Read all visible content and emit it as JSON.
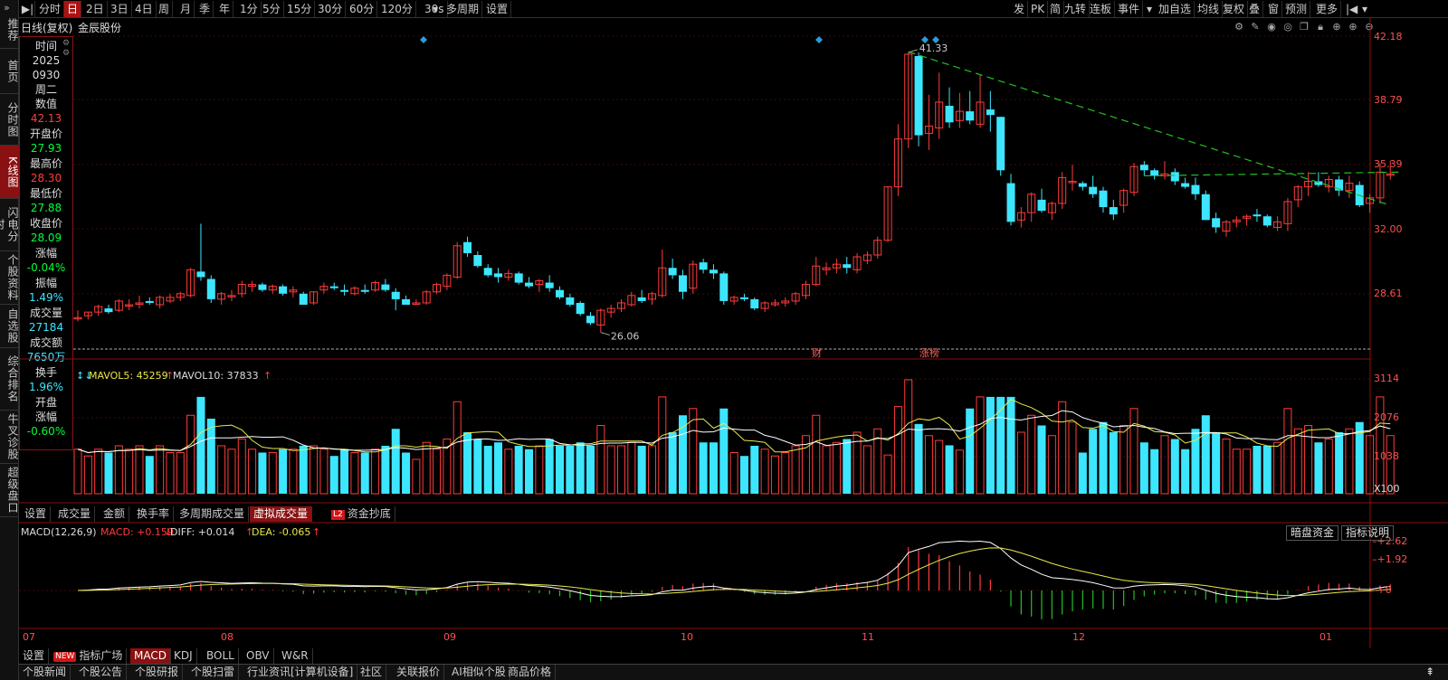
{
  "left_nav": [
    "推荐",
    "首页",
    "分时图",
    "K线图",
    "闪电分时",
    "个股资料",
    "自选股",
    "综合排名",
    "牛叉诊股",
    "超级盘口"
  ],
  "left_nav_active": "K线图",
  "toolbar": {
    "left": [
      "分时",
      "日",
      "2日",
      "3日",
      "4日",
      "周",
      "月",
      "季",
      "年",
      "1分",
      "5分",
      "15分",
      "30分",
      "60分",
      "120分",
      "30s",
      "多周期",
      "设置"
    ],
    "active": "日",
    "right": [
      "发",
      "PK",
      "简",
      "九转",
      "连板",
      "事件",
      "加自选",
      "均线",
      "复权",
      "叠",
      "窗",
      "预测",
      "更多"
    ]
  },
  "chart_header": {
    "mode": "日线(复权)",
    "stock_name": "金辰股份"
  },
  "info_panel": [
    {
      "label": "时间",
      "value": ""
    },
    {
      "label": "2025",
      "value": "",
      "style": "white"
    },
    {
      "label": "0930",
      "value": "",
      "style": "white"
    },
    {
      "label": "周二",
      "value": ""
    },
    {
      "label": "数值",
      "value": "42.13",
      "style": "red"
    },
    {
      "label": "开盘价",
      "value": "27.93",
      "style": "green"
    },
    {
      "label": "最高价",
      "value": "28.30",
      "style": "red"
    },
    {
      "label": "最低价",
      "value": "27.88",
      "style": "green"
    },
    {
      "label": "收盘价",
      "value": "28.09",
      "style": "green"
    },
    {
      "label": "涨幅",
      "value": "-0.04%",
      "style": "green"
    },
    {
      "label": "振幅",
      "value": "1.49%",
      "style": "cyan"
    },
    {
      "label": "成交量",
      "value": "27184",
      "style": "cyan"
    },
    {
      "label": "成交额",
      "value": "7650万",
      "style": "cyan"
    },
    {
      "label": "换手",
      "value": "1.96%",
      "style": "cyan"
    },
    {
      "label": "开盘",
      "value": "",
      "style": "white"
    },
    {
      "label": "涨幅",
      "value": "-0.60%",
      "style": "green"
    }
  ],
  "price_axis": [
    "42.18",
    "38.79",
    "35.39",
    "32.00",
    "28.61"
  ],
  "price_annotations": {
    "high": "41.33",
    "low": "26.06"
  },
  "event_markers": [
    "财",
    "涨榜"
  ],
  "volume_legend": {
    "mavol5_label": "MAVOL5: 45259",
    "mavol10_label": "MAVOL10: 37833"
  },
  "volume_axis": [
    "3114",
    "2076",
    "1038",
    "X100"
  ],
  "indicator_tabs": [
    "设置",
    "成交量",
    "金额",
    "换手率",
    "多周期成交量",
    "虚拟成交量",
    "资金抄底"
  ],
  "indicator_tabs_active": "虚拟成交量",
  "indicator_l2_tab": "资金抄底",
  "macd_legend": {
    "title": "MACD(12,26,9)",
    "macd": "MACD: +0.159",
    "diff": "DIFF: +0.014",
    "dea": "DEA: -0.065"
  },
  "macd_buttons": [
    "暗盘资金",
    "指标说明"
  ],
  "macd_axis": [
    "+2.62",
    "+1.92",
    "+0"
  ],
  "date_axis": [
    "07",
    "08",
    "09",
    "10",
    "11",
    "12",
    "01"
  ],
  "bottom_tabs": [
    "设置",
    "指标广场",
    "MACD",
    "KDJ",
    "BOLL",
    "OBV",
    "W&R"
  ],
  "bottom_tabs_new": "指标广场",
  "bottom_tabs_active": "MACD",
  "footer_tabs": [
    "个股新闻",
    "个股公告",
    "个股研报",
    "个股扫雷",
    "行业资讯[计算机设备]",
    "社区",
    "关联报价",
    "AI相似个股",
    "商品价格"
  ],
  "colors": {
    "up": "#ff3b3b",
    "down": "#3ce6ff",
    "ma5": "#e8e84a",
    "ma10": "#ffffff",
    "accent": "#b01010",
    "trend": "#22c022"
  },
  "chart_data": {
    "type": "candlestick",
    "ylim": [
      24.9,
      42.18
    ],
    "candles": [
      [
        26.9,
        27.3,
        26.7,
        26.9
      ],
      [
        27.0,
        27.2,
        26.8,
        27.2
      ],
      [
        27.2,
        27.6,
        27.0,
        27.5
      ],
      [
        27.4,
        27.6,
        27.1,
        27.2
      ],
      [
        27.3,
        27.9,
        27.2,
        27.8
      ],
      [
        27.6,
        27.9,
        27.3,
        27.6
      ],
      [
        27.7,
        28.1,
        27.4,
        27.7
      ],
      [
        27.8,
        28.0,
        27.6,
        27.7
      ],
      [
        27.6,
        28.1,
        27.4,
        28.0
      ],
      [
        27.8,
        28.2,
        27.7,
        28.0
      ],
      [
        28.0,
        28.3,
        27.8,
        28.2
      ],
      [
        28.1,
        29.6,
        28.0,
        29.5
      ],
      [
        29.4,
        32.0,
        28.9,
        29.1
      ],
      [
        29.0,
        29.2,
        27.7,
        27.9
      ],
      [
        27.9,
        28.3,
        27.6,
        28.2
      ],
      [
        28.1,
        28.4,
        27.8,
        28.1
      ],
      [
        28.2,
        28.9,
        28.0,
        28.7
      ],
      [
        28.6,
        28.9,
        28.3,
        28.7
      ],
      [
        28.7,
        28.8,
        28.3,
        28.4
      ],
      [
        28.4,
        28.7,
        28.2,
        28.6
      ],
      [
        28.6,
        28.7,
        28.1,
        28.2
      ],
      [
        28.3,
        28.6,
        28.0,
        28.4
      ],
      [
        28.2,
        28.3,
        27.6,
        27.6
      ],
      [
        27.7,
        28.3,
        27.6,
        28.3
      ],
      [
        28.4,
        28.8,
        28.2,
        28.6
      ],
      [
        28.6,
        28.8,
        28.4,
        28.5
      ],
      [
        28.4,
        28.7,
        28.1,
        28.3
      ],
      [
        28.2,
        28.6,
        28.1,
        28.5
      ],
      [
        28.4,
        28.7,
        28.2,
        28.3
      ],
      [
        28.4,
        28.9,
        28.3,
        28.8
      ],
      [
        28.7,
        29.0,
        28.3,
        28.4
      ],
      [
        28.3,
        28.5,
        27.3,
        27.9
      ],
      [
        27.9,
        28.1,
        27.6,
        27.6
      ],
      [
        27.7,
        27.9,
        27.6,
        27.7
      ],
      [
        27.7,
        28.4,
        27.6,
        28.3
      ],
      [
        28.3,
        28.8,
        28.2,
        28.7
      ],
      [
        28.6,
        29.3,
        28.4,
        29.2
      ],
      [
        29.1,
        31.0,
        29.0,
        30.8
      ],
      [
        31.0,
        31.3,
        30.2,
        30.4
      ],
      [
        30.3,
        30.5,
        29.6,
        29.7
      ],
      [
        29.6,
        29.8,
        29.1,
        29.2
      ],
      [
        29.3,
        29.6,
        28.8,
        29.1
      ],
      [
        29.1,
        29.5,
        28.9,
        29.3
      ],
      [
        29.3,
        29.4,
        28.7,
        28.8
      ],
      [
        28.8,
        29.1,
        28.5,
        28.6
      ],
      [
        28.7,
        29.0,
        28.3,
        28.9
      ],
      [
        28.8,
        29.2,
        28.3,
        28.5
      ],
      [
        28.4,
        28.6,
        27.9,
        28.0
      ],
      [
        28.0,
        28.2,
        27.5,
        27.6
      ],
      [
        27.7,
        27.8,
        27.0,
        27.1
      ],
      [
        27.0,
        27.2,
        26.5,
        26.6
      ],
      [
        26.5,
        27.4,
        26.1,
        27.3
      ],
      [
        27.2,
        27.6,
        26.9,
        27.4
      ],
      [
        27.4,
        27.9,
        27.2,
        27.7
      ],
      [
        27.6,
        28.3,
        27.5,
        28.1
      ],
      [
        28.0,
        28.4,
        27.7,
        27.8
      ],
      [
        27.9,
        28.3,
        27.6,
        28.2
      ],
      [
        28.1,
        30.6,
        28.0,
        29.6
      ],
      [
        29.6,
        30.1,
        29.0,
        29.2
      ],
      [
        29.2,
        29.5,
        27.9,
        28.3
      ],
      [
        28.5,
        30.0,
        28.2,
        29.8
      ],
      [
        29.9,
        30.1,
        29.3,
        29.5
      ],
      [
        29.5,
        29.8,
        29.0,
        29.3
      ],
      [
        29.3,
        29.4,
        27.6,
        27.8
      ],
      [
        27.8,
        28.1,
        27.6,
        28.0
      ],
      [
        28.0,
        28.2,
        27.8,
        27.9
      ],
      [
        27.9,
        28.0,
        27.3,
        27.4
      ],
      [
        27.4,
        27.8,
        27.2,
        27.7
      ],
      [
        27.6,
        27.9,
        27.5,
        27.7
      ],
      [
        27.7,
        28.0,
        27.5,
        27.8
      ],
      [
        27.8,
        28.3,
        27.6,
        28.2
      ],
      [
        28.1,
        28.9,
        27.9,
        28.7
      ],
      [
        28.7,
        30.2,
        28.6,
        29.7
      ],
      [
        29.5,
        29.9,
        29.2,
        29.6
      ],
      [
        29.6,
        30.1,
        29.3,
        29.8
      ],
      [
        29.8,
        30.2,
        29.3,
        29.6
      ],
      [
        29.5,
        30.4,
        29.3,
        30.2
      ],
      [
        30.0,
        30.5,
        29.8,
        30.3
      ],
      [
        30.3,
        31.3,
        30.1,
        31.1
      ],
      [
        31.1,
        34.0,
        31.0,
        34.0
      ],
      [
        34.0,
        37.4,
        33.5,
        36.6
      ],
      [
        36.6,
        41.3,
        36.1,
        41.2
      ],
      [
        41.1,
        41.3,
        36.2,
        36.8
      ],
      [
        36.9,
        39.0,
        36.0,
        37.3
      ],
      [
        37.2,
        40.2,
        36.6,
        38.6
      ],
      [
        38.4,
        39.4,
        37.2,
        37.5
      ],
      [
        37.6,
        39.1,
        37.2,
        38.1
      ],
      [
        38.1,
        39.2,
        37.4,
        37.6
      ],
      [
        37.4,
        40.1,
        37.2,
        38.6
      ],
      [
        38.2,
        39.2,
        37.0,
        37.9
      ],
      [
        37.8,
        37.8,
        34.6,
        34.9
      ],
      [
        34.2,
        34.7,
        31.9,
        32.1
      ],
      [
        32.2,
        32.9,
        31.8,
        32.6
      ],
      [
        32.6,
        33.7,
        32.1,
        33.6
      ],
      [
        33.3,
        33.9,
        32.6,
        32.7
      ],
      [
        32.6,
        33.2,
        32.2,
        33.1
      ],
      [
        33.1,
        34.8,
        32.8,
        34.5
      ],
      [
        34.3,
        35.2,
        33.8,
        34.3
      ],
      [
        34.2,
        34.3,
        33.8,
        34.0
      ],
      [
        34.0,
        34.6,
        33.4,
        33.6
      ],
      [
        33.8,
        34.0,
        32.6,
        32.9
      ],
      [
        32.9,
        33.3,
        32.2,
        32.5
      ],
      [
        33.0,
        33.9,
        32.6,
        33.8
      ],
      [
        33.7,
        35.3,
        33.5,
        35.1
      ],
      [
        35.2,
        35.4,
        34.6,
        34.9
      ],
      [
        34.9,
        35.0,
        34.4,
        34.6
      ],
      [
        34.6,
        35.4,
        34.4,
        34.7
      ],
      [
        34.8,
        35.0,
        34.1,
        34.3
      ],
      [
        34.2,
        34.5,
        33.9,
        34.0
      ],
      [
        34.1,
        34.5,
        33.3,
        33.6
      ],
      [
        33.6,
        33.8,
        32.2,
        32.2
      ],
      [
        32.3,
        32.6,
        31.5,
        31.8
      ],
      [
        31.6,
        32.2,
        31.3,
        32.1
      ],
      [
        32.1,
        32.4,
        31.8,
        32.2
      ],
      [
        32.3,
        32.5,
        31.9,
        32.4
      ],
      [
        32.5,
        32.8,
        32.1,
        32.4
      ],
      [
        32.4,
        32.5,
        31.8,
        31.9
      ],
      [
        31.8,
        32.4,
        31.6,
        32.1
      ],
      [
        32.0,
        33.4,
        31.6,
        33.2
      ],
      [
        33.3,
        34.1,
        32.9,
        34.0
      ],
      [
        34.0,
        34.8,
        33.5,
        34.3
      ],
      [
        34.3,
        34.8,
        34.0,
        34.1
      ],
      [
        34.0,
        34.6,
        33.7,
        34.4
      ],
      [
        34.4,
        34.6,
        33.5,
        33.8
      ],
      [
        33.8,
        34.6,
        33.4,
        34.2
      ],
      [
        34.1,
        34.3,
        32.9,
        33.0
      ],
      [
        33.1,
        33.6,
        32.6,
        33.4
      ],
      [
        33.4,
        35.3,
        33.1,
        34.8
      ],
      [
        34.7,
        35.4,
        34.4,
        34.7
      ]
    ],
    "trendlines": [
      {
        "from": [
          81,
          41.33
        ],
        "to": [
          128,
          33.0
        ],
        "style": "dashed",
        "color": "#22c022"
      },
      {
        "from": [
          104,
          34.6
        ],
        "to": [
          129,
          34.8
        ],
        "style": "dashed",
        "color": "#22c022"
      }
    ]
  }
}
